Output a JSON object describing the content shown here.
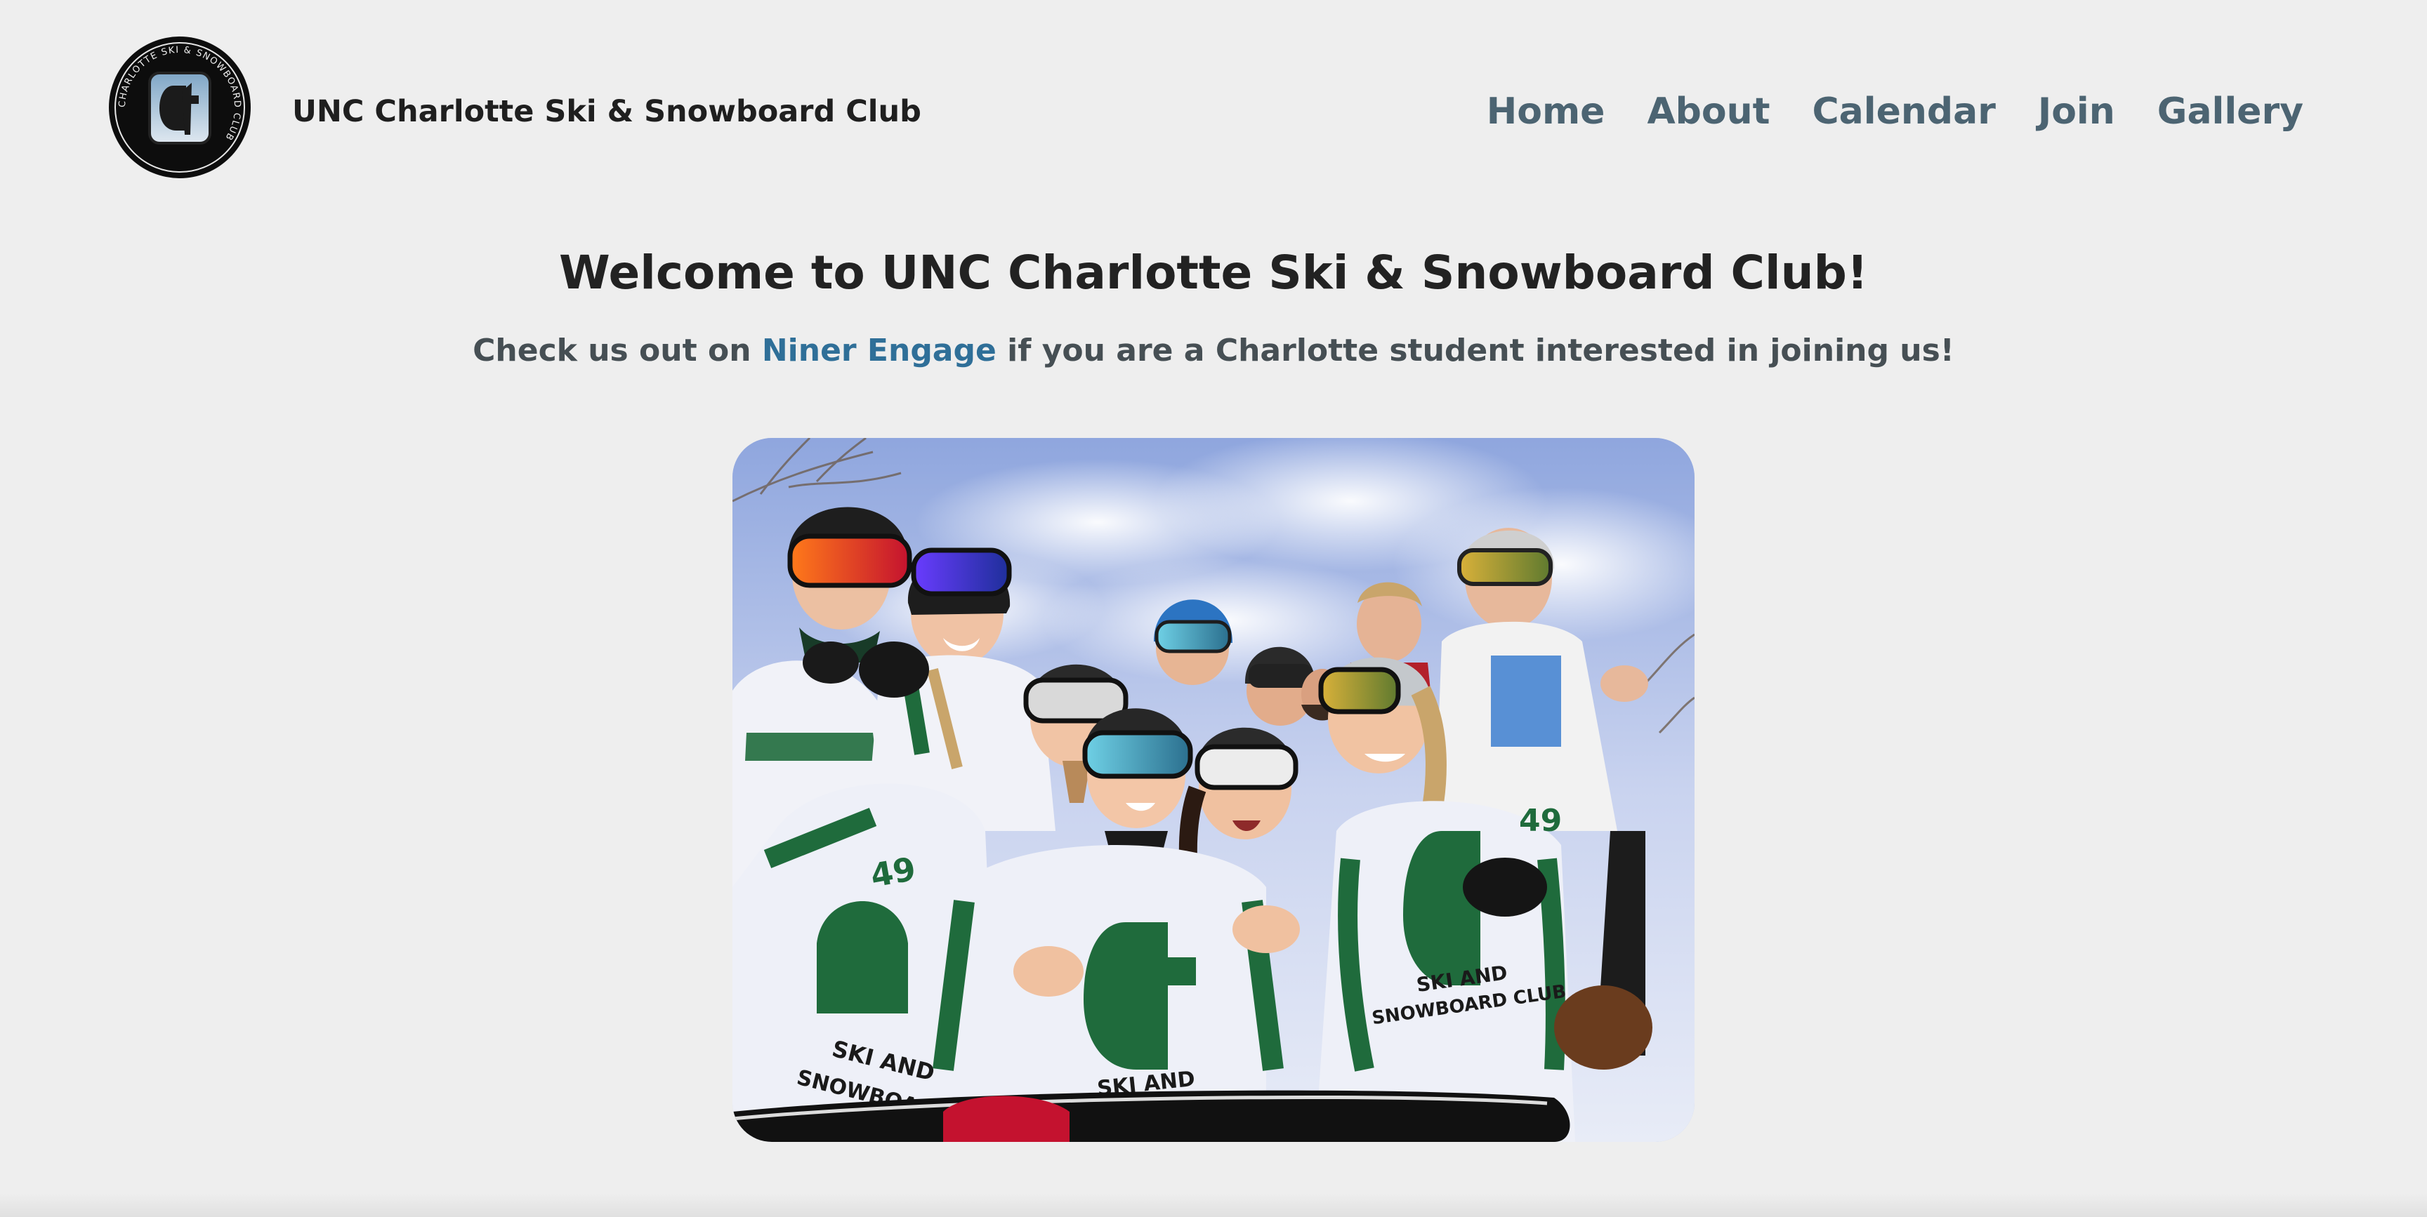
{
  "header": {
    "logo_icon": "club-logo-icon",
    "logo_ring_text": "CHARLOTTE SKI & SNOWBOARD CLUB",
    "club_name": "UNC Charlotte Ski & Snowboard Club"
  },
  "nav": {
    "items": [
      {
        "label": "Home"
      },
      {
        "label": "About"
      },
      {
        "label": "Calendar"
      },
      {
        "label": "Join"
      },
      {
        "label": "Gallery"
      }
    ]
  },
  "hero": {
    "title": "Welcome to UNC Charlotte Ski & Snowboard Club!",
    "subtitle_prefix": "Check us out on ",
    "subtitle_link": "Niner Engage",
    "subtitle_suffix": " if you are a Charlotte student interested in joining us!"
  },
  "photo": {
    "jersey_number": "49",
    "jersey_text_line1": "SKI AND",
    "jersey_text_line2": "SNOWBOARD CLUB"
  },
  "colors": {
    "background": "#eeeeee",
    "nav_text": "#4c6472",
    "link": "#2f6f98",
    "jersey_green": "#1f6b3c"
  }
}
